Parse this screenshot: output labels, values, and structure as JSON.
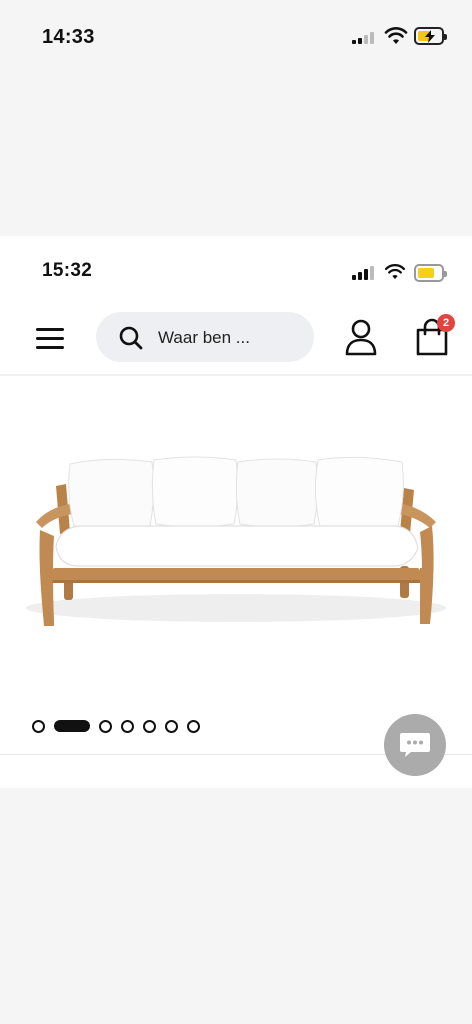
{
  "outer_status": {
    "time": "14:33"
  },
  "inner_status": {
    "time": "15:32"
  },
  "header": {
    "menu_icon": "hamburger-menu-icon",
    "search": {
      "placeholder": "Waar ben ...",
      "icon": "search-icon"
    },
    "account_icon": "user-icon",
    "cart": {
      "icon": "shopping-bag-icon",
      "count": "2"
    }
  },
  "product": {
    "image": "wooden-sofa-with-white-cushions"
  },
  "carousel": {
    "total": 7,
    "active_index": 1
  },
  "chat": {
    "icon": "chat-bubble-icon"
  },
  "colors": {
    "badge": "#e2453d",
    "search_bg": "#eeeff3",
    "chat_fab": "#ababab"
  }
}
